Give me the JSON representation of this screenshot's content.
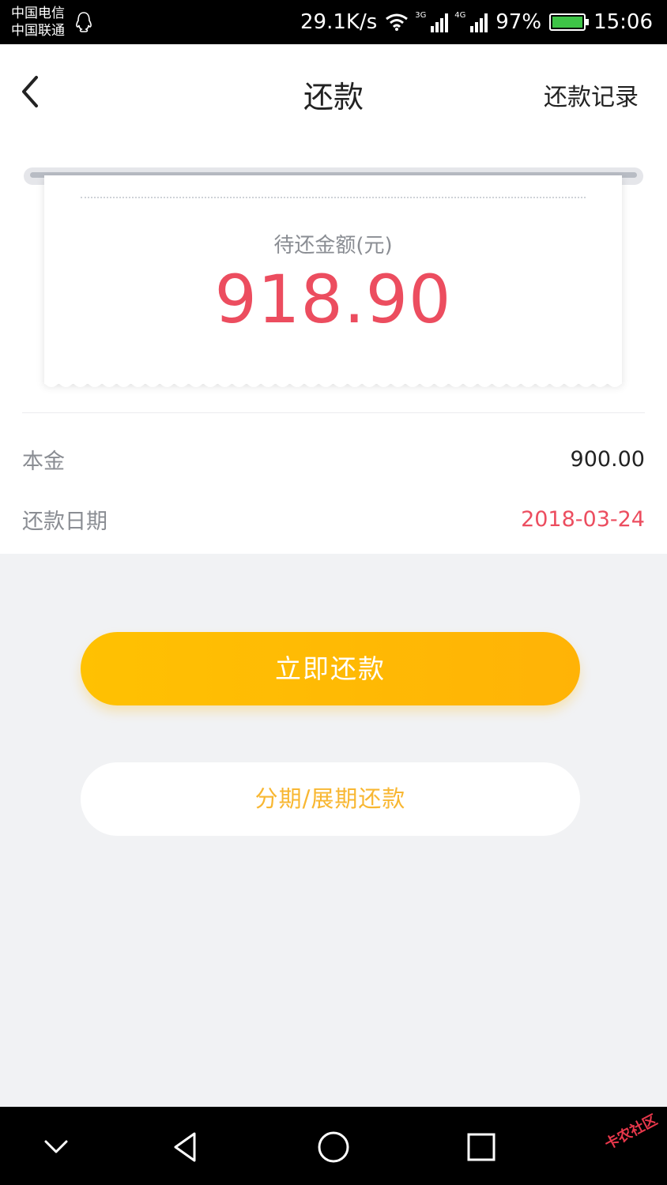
{
  "status_bar": {
    "carrier_1": "中国电信",
    "carrier_2": "中国联通",
    "speed": "29.1K/s",
    "network_tag_1": "3G",
    "network_tag_2": "4G",
    "battery": "97%",
    "time": "15:06"
  },
  "nav": {
    "title": "还款",
    "right_link": "还款记录"
  },
  "loan": {
    "amount_label": "待还金额(元)",
    "amount_value": "918.90",
    "principal_label": "本金",
    "principal_value": "900.00",
    "due_label": "还款日期",
    "due_value": "2018-03-24"
  },
  "actions": {
    "repay_now": "立即还款",
    "installment": "分期/展期还款"
  },
  "watermark": "卡农社区",
  "colors": {
    "accent_red": "#ec4d5f",
    "button_yellow": "#ffb306",
    "secondary_text": "#f8b732"
  }
}
